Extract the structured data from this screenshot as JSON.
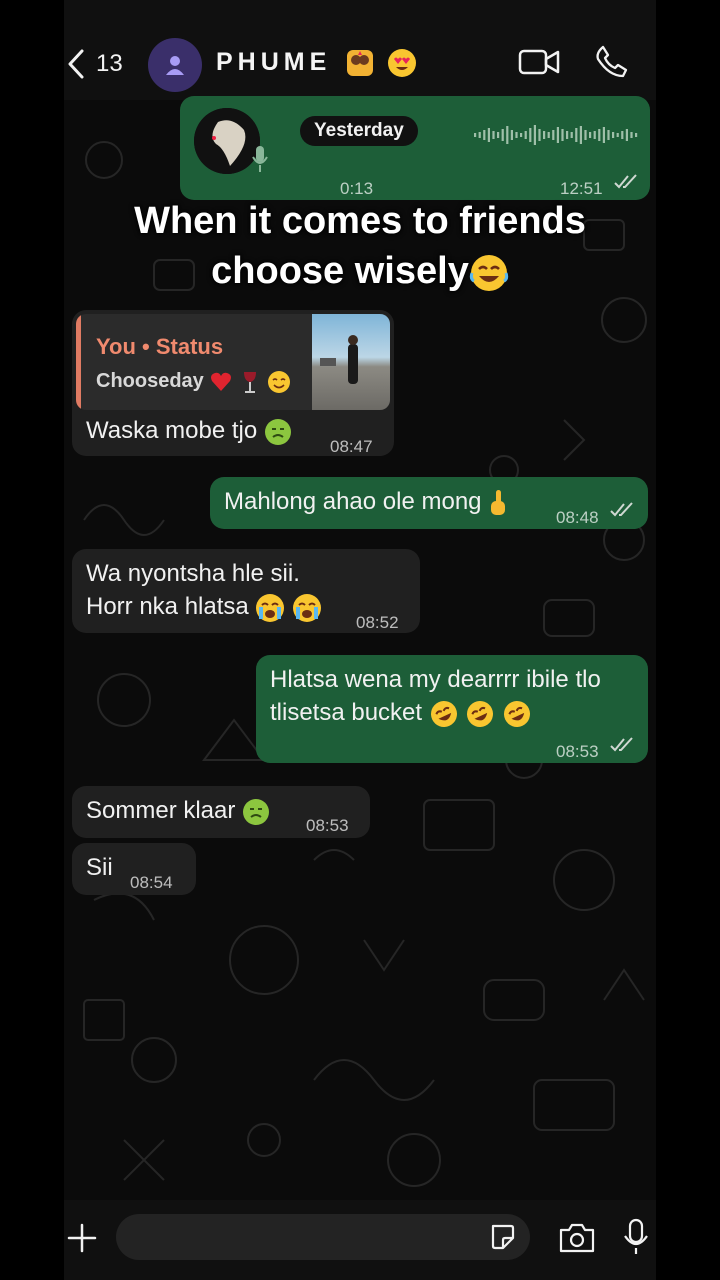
{
  "header": {
    "back_count": "13",
    "contact_name": "PHUME"
  },
  "voice_note": {
    "date_pill": "Yesterday",
    "duration": "0:13",
    "time": "12:51"
  },
  "caption": {
    "line1": "When it comes to friends",
    "line2": "choose wisely"
  },
  "messages": [
    {
      "type": "in",
      "quote_author": "You • Status",
      "quote_text": "Chooseday",
      "text": "Waska mobe tjo",
      "time": "08:47"
    },
    {
      "type": "out",
      "text": "Mahlong ahao ole mong",
      "time": "08:48"
    },
    {
      "type": "in",
      "line1": "Wa nyontsha hle sii.",
      "line2": "Horr nka hlatsa",
      "time": "08:52"
    },
    {
      "type": "out",
      "line1": "Hlatsa wena my dearrrr ibile tlo",
      "line2": "tlisetsa bucket",
      "time": "08:53"
    },
    {
      "type": "in",
      "text": "Sommer klaar",
      "time": "08:53"
    },
    {
      "type": "in",
      "text": "Sii",
      "time": "08:54"
    }
  ],
  "input_bar": {
    "placeholder": ""
  },
  "colors": {
    "outgoing": "#1d5e38",
    "incoming": "#202020",
    "background": "#0b0b0b",
    "read_ticks": "#dcdcdc"
  }
}
